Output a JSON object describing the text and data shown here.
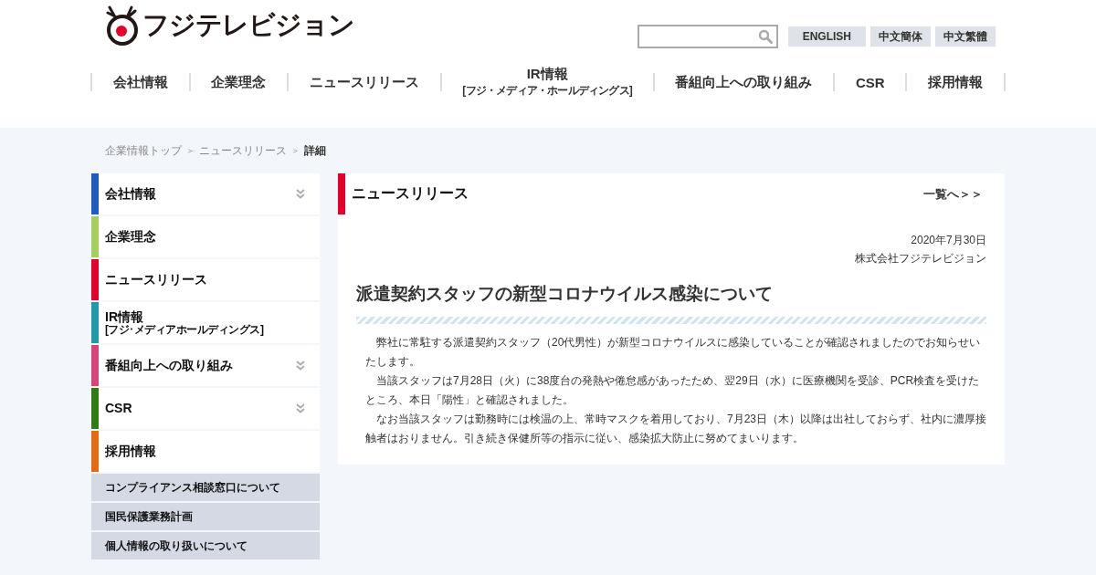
{
  "header": {
    "logo_text": "フジテレビジョン",
    "languages": [
      "ENGLISH",
      "中文簡体",
      "中文繁體"
    ],
    "nav": [
      {
        "label": "会社情報"
      },
      {
        "label": "企業理念"
      },
      {
        "label": "ニュースリリース"
      },
      {
        "label": "IR情報",
        "sub": "[フジ・メディア・ホールディングス]"
      },
      {
        "label": "番組向上への取り組み"
      },
      {
        "label": "CSR"
      },
      {
        "label": "採用情報"
      }
    ]
  },
  "breadcrumb": [
    {
      "label": "企業情報トップ",
      "kind": "link"
    },
    {
      "label": "＞",
      "kind": "sep"
    },
    {
      "label": "ニュースリリース",
      "kind": "link"
    },
    {
      "label": "＞",
      "kind": "sep"
    },
    {
      "label": "詳細",
      "kind": "current"
    }
  ],
  "sidebar": {
    "items": [
      {
        "label": "会社情報",
        "color": "#1f5bc1",
        "expandable": true
      },
      {
        "label": "企業理念",
        "color": "#a6d05e",
        "expandable": false
      },
      {
        "label": "ニュースリリース",
        "color": "#e4002b",
        "expandable": false
      },
      {
        "label": "IR情報",
        "sub": "[フジ･メディアホールディングス]",
        "color": "#1f9aa8",
        "expandable": false
      },
      {
        "label": "番組向上への取り組み",
        "color": "#d9447a",
        "expandable": true
      },
      {
        "label": "CSR",
        "color": "#2f7d12",
        "expandable": true
      },
      {
        "label": "採用情報",
        "color": "#e66a0f",
        "expandable": false
      }
    ],
    "links": [
      "コンプライアンス相談窓口について",
      "国民保護業務計画",
      "個人情報の取り扱いについて"
    ]
  },
  "article": {
    "section_title": "ニュースリリース",
    "list_link": "一覧へ＞＞",
    "date": "2020年7月30日",
    "company": "株式会社フジテレビジョン",
    "title": "派遣契約スタッフの新型コロナウイルス感染について",
    "paragraphs": [
      "弊社に常駐する派遣契約スタッフ（20代男性）が新型コロナウイルスに感染していることが確認されましたのでお知らせいたします。",
      "当該スタッフは7月28日（火）に38度台の発熱や倦怠感があったため、翌29日（水）に医療機関を受診、PCR検査を受けたところ、本日「陽性」と確認されました。",
      "なお当該スタッフは勤務時には検温の上、常時マスクを着用しており、7月23日（木）以降は出社しておらず、社内に濃厚接触者はおりません。引き続き保健所等の指示に従い、感染拡大防止に努めてまいります。"
    ]
  }
}
